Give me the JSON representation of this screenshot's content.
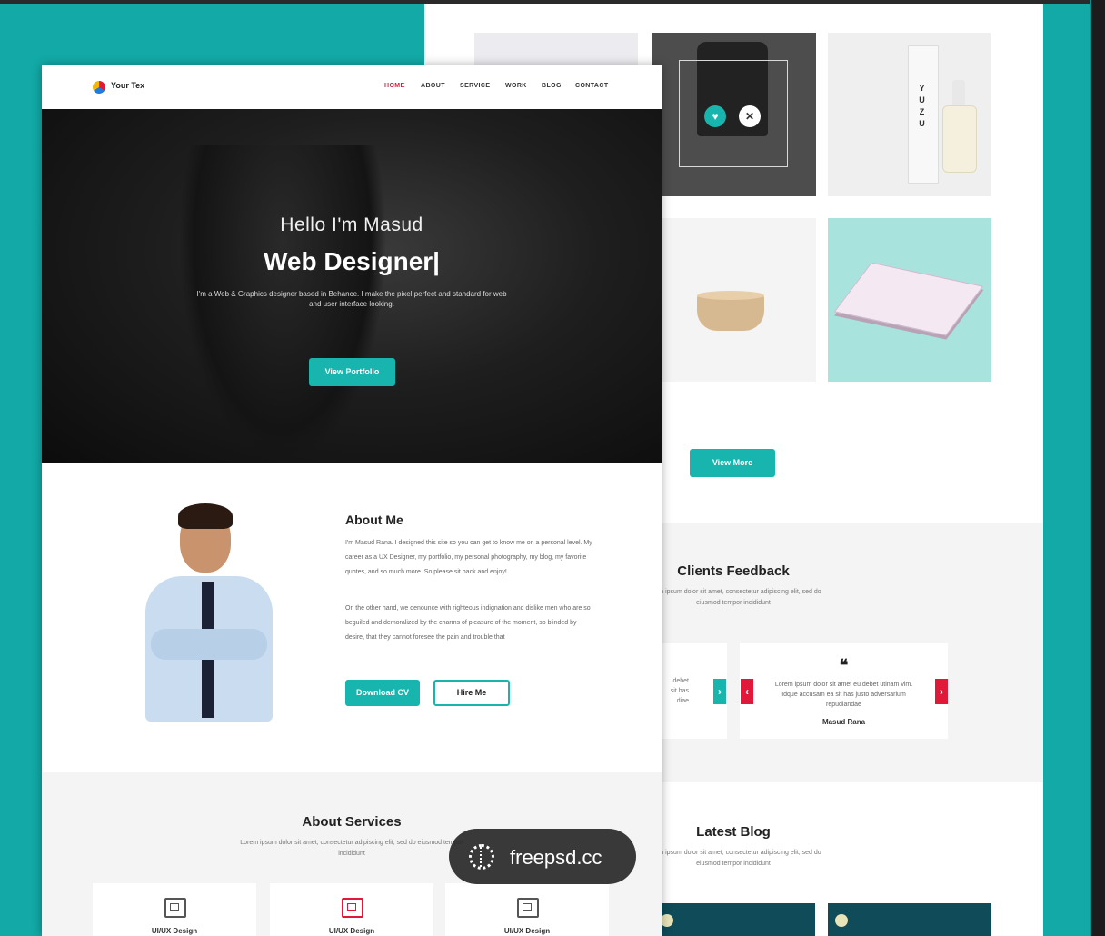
{
  "colors": {
    "accent": "#17b5ad",
    "active": "#e0193a",
    "background": "#12a9a6"
  },
  "front": {
    "logo_text": "Your Tex",
    "menu": [
      "HOME",
      "ABOUT",
      "SERVICE",
      "WORK",
      "BLOG",
      "CONTACT"
    ],
    "hero": {
      "greeting": "Hello I'm Masud",
      "role": "Web Designer|",
      "description": "I'm a Web & Graphics designer based in Behance. I make the pixel perfect and standard for web and user interface looking.",
      "button": "View Portfolio"
    },
    "about": {
      "title": "About Me",
      "p1": "I'm Masud Rana. I designed this site so you can get to know me on a personal level. My career as a UX Designer, my portfolio, my personal photography, my blog, my favorite quotes, and so much more. So please sit back and enjoy!",
      "p2": "On the other hand, we denounce with righteous indignation and dislike men who are so beguiled and demoralized by the charms of pleasure of the moment, so blinded by desire, that they cannot foresee the pain and trouble that",
      "download_button": "Download CV",
      "hire_button": "Hire Me"
    },
    "services": {
      "title": "About Services",
      "subtitle": "Lorem ipsum dolor sit amet, consectetur adipiscing elit, sed do eiusmod tempor incididunt",
      "cards": [
        "UI/UX Design",
        "UI/UX Design",
        "UI/UX Design"
      ]
    }
  },
  "back": {
    "product_box_text": "YUZU",
    "view_more": "View More",
    "feedback": {
      "title": "Clients Feedback",
      "subtitle": "Lorem ipsum dolor sit amet, consectetur adipiscing elit, sed do eiusmod tempor incididunt",
      "partial_text": "debet\nsit has\ndiae",
      "quote": "Lorem ipsum dolor sit amet eu debet utinam vim. Idque accusam ea sit has justo adversarium repudiandae",
      "author": "Masud Rana"
    },
    "blog": {
      "title": "Latest Blog",
      "subtitle": "Lorem ipsum dolor sit amet, consectetur adipiscing elit, sed do eiusmod tempor incididunt"
    }
  },
  "watermark": "freepsd.cc"
}
